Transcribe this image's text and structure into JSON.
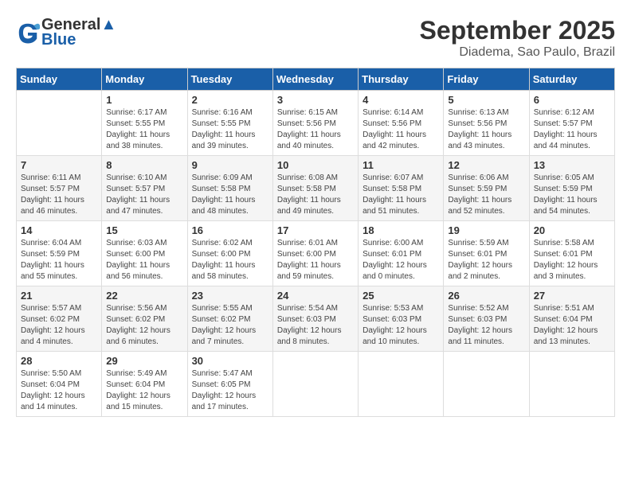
{
  "header": {
    "logo_line1": "General",
    "logo_line2": "Blue",
    "month": "September 2025",
    "location": "Diadema, Sao Paulo, Brazil"
  },
  "days_of_week": [
    "Sunday",
    "Monday",
    "Tuesday",
    "Wednesday",
    "Thursday",
    "Friday",
    "Saturday"
  ],
  "weeks": [
    [
      {
        "day": "",
        "sunrise": "",
        "sunset": "",
        "daylight": ""
      },
      {
        "day": "1",
        "sunrise": "Sunrise: 6:17 AM",
        "sunset": "Sunset: 5:55 PM",
        "daylight": "Daylight: 11 hours and 38 minutes."
      },
      {
        "day": "2",
        "sunrise": "Sunrise: 6:16 AM",
        "sunset": "Sunset: 5:55 PM",
        "daylight": "Daylight: 11 hours and 39 minutes."
      },
      {
        "day": "3",
        "sunrise": "Sunrise: 6:15 AM",
        "sunset": "Sunset: 5:56 PM",
        "daylight": "Daylight: 11 hours and 40 minutes."
      },
      {
        "day": "4",
        "sunrise": "Sunrise: 6:14 AM",
        "sunset": "Sunset: 5:56 PM",
        "daylight": "Daylight: 11 hours and 42 minutes."
      },
      {
        "day": "5",
        "sunrise": "Sunrise: 6:13 AM",
        "sunset": "Sunset: 5:56 PM",
        "daylight": "Daylight: 11 hours and 43 minutes."
      },
      {
        "day": "6",
        "sunrise": "Sunrise: 6:12 AM",
        "sunset": "Sunset: 5:57 PM",
        "daylight": "Daylight: 11 hours and 44 minutes."
      }
    ],
    [
      {
        "day": "7",
        "sunrise": "Sunrise: 6:11 AM",
        "sunset": "Sunset: 5:57 PM",
        "daylight": "Daylight: 11 hours and 46 minutes."
      },
      {
        "day": "8",
        "sunrise": "Sunrise: 6:10 AM",
        "sunset": "Sunset: 5:57 PM",
        "daylight": "Daylight: 11 hours and 47 minutes."
      },
      {
        "day": "9",
        "sunrise": "Sunrise: 6:09 AM",
        "sunset": "Sunset: 5:58 PM",
        "daylight": "Daylight: 11 hours and 48 minutes."
      },
      {
        "day": "10",
        "sunrise": "Sunrise: 6:08 AM",
        "sunset": "Sunset: 5:58 PM",
        "daylight": "Daylight: 11 hours and 49 minutes."
      },
      {
        "day": "11",
        "sunrise": "Sunrise: 6:07 AM",
        "sunset": "Sunset: 5:58 PM",
        "daylight": "Daylight: 11 hours and 51 minutes."
      },
      {
        "day": "12",
        "sunrise": "Sunrise: 6:06 AM",
        "sunset": "Sunset: 5:59 PM",
        "daylight": "Daylight: 11 hours and 52 minutes."
      },
      {
        "day": "13",
        "sunrise": "Sunrise: 6:05 AM",
        "sunset": "Sunset: 5:59 PM",
        "daylight": "Daylight: 11 hours and 54 minutes."
      }
    ],
    [
      {
        "day": "14",
        "sunrise": "Sunrise: 6:04 AM",
        "sunset": "Sunset: 5:59 PM",
        "daylight": "Daylight: 11 hours and 55 minutes."
      },
      {
        "day": "15",
        "sunrise": "Sunrise: 6:03 AM",
        "sunset": "Sunset: 6:00 PM",
        "daylight": "Daylight: 11 hours and 56 minutes."
      },
      {
        "day": "16",
        "sunrise": "Sunrise: 6:02 AM",
        "sunset": "Sunset: 6:00 PM",
        "daylight": "Daylight: 11 hours and 58 minutes."
      },
      {
        "day": "17",
        "sunrise": "Sunrise: 6:01 AM",
        "sunset": "Sunset: 6:00 PM",
        "daylight": "Daylight: 11 hours and 59 minutes."
      },
      {
        "day": "18",
        "sunrise": "Sunrise: 6:00 AM",
        "sunset": "Sunset: 6:01 PM",
        "daylight": "Daylight: 12 hours and 0 minutes."
      },
      {
        "day": "19",
        "sunrise": "Sunrise: 5:59 AM",
        "sunset": "Sunset: 6:01 PM",
        "daylight": "Daylight: 12 hours and 2 minutes."
      },
      {
        "day": "20",
        "sunrise": "Sunrise: 5:58 AM",
        "sunset": "Sunset: 6:01 PM",
        "daylight": "Daylight: 12 hours and 3 minutes."
      }
    ],
    [
      {
        "day": "21",
        "sunrise": "Sunrise: 5:57 AM",
        "sunset": "Sunset: 6:02 PM",
        "daylight": "Daylight: 12 hours and 4 minutes."
      },
      {
        "day": "22",
        "sunrise": "Sunrise: 5:56 AM",
        "sunset": "Sunset: 6:02 PM",
        "daylight": "Daylight: 12 hours and 6 minutes."
      },
      {
        "day": "23",
        "sunrise": "Sunrise: 5:55 AM",
        "sunset": "Sunset: 6:02 PM",
        "daylight": "Daylight: 12 hours and 7 minutes."
      },
      {
        "day": "24",
        "sunrise": "Sunrise: 5:54 AM",
        "sunset": "Sunset: 6:03 PM",
        "daylight": "Daylight: 12 hours and 8 minutes."
      },
      {
        "day": "25",
        "sunrise": "Sunrise: 5:53 AM",
        "sunset": "Sunset: 6:03 PM",
        "daylight": "Daylight: 12 hours and 10 minutes."
      },
      {
        "day": "26",
        "sunrise": "Sunrise: 5:52 AM",
        "sunset": "Sunset: 6:03 PM",
        "daylight": "Daylight: 12 hours and 11 minutes."
      },
      {
        "day": "27",
        "sunrise": "Sunrise: 5:51 AM",
        "sunset": "Sunset: 6:04 PM",
        "daylight": "Daylight: 12 hours and 13 minutes."
      }
    ],
    [
      {
        "day": "28",
        "sunrise": "Sunrise: 5:50 AM",
        "sunset": "Sunset: 6:04 PM",
        "daylight": "Daylight: 12 hours and 14 minutes."
      },
      {
        "day": "29",
        "sunrise": "Sunrise: 5:49 AM",
        "sunset": "Sunset: 6:04 PM",
        "daylight": "Daylight: 12 hours and 15 minutes."
      },
      {
        "day": "30",
        "sunrise": "Sunrise: 5:47 AM",
        "sunset": "Sunset: 6:05 PM",
        "daylight": "Daylight: 12 hours and 17 minutes."
      },
      {
        "day": "",
        "sunrise": "",
        "sunset": "",
        "daylight": ""
      },
      {
        "day": "",
        "sunrise": "",
        "sunset": "",
        "daylight": ""
      },
      {
        "day": "",
        "sunrise": "",
        "sunset": "",
        "daylight": ""
      },
      {
        "day": "",
        "sunrise": "",
        "sunset": "",
        "daylight": ""
      }
    ]
  ]
}
